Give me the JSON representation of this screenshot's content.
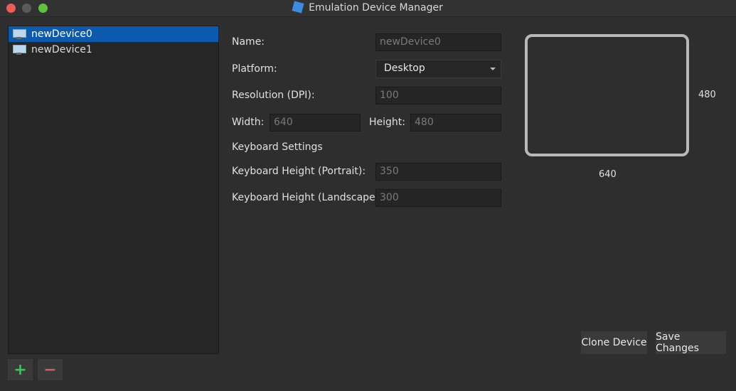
{
  "window": {
    "title": "Emulation Device Manager"
  },
  "devices": [
    {
      "label": "newDevice0",
      "selected": true
    },
    {
      "label": "newDevice1",
      "selected": false
    }
  ],
  "form": {
    "name_label": "Name:",
    "name_value": "newDevice0",
    "platform_label": "Platform:",
    "platform_value": "Desktop",
    "resolution_label": "Resolution (DPI):",
    "resolution_value": "100",
    "width_label": "Width:",
    "width_value": "640",
    "height_label": "Height:",
    "height_value": "480",
    "keyboard_section": "Keyboard Settings",
    "kb_portrait_label": "Keyboard Height (Portrait):",
    "kb_portrait_value": "350",
    "kb_landscape_label": "Keyboard Height (Landscape):",
    "kb_landscape_value": "300"
  },
  "preview": {
    "width": "640",
    "height": "480"
  },
  "buttons": {
    "clone": "Clone Device",
    "save": "Save Changes",
    "add": "+",
    "remove": "−"
  },
  "colors": {
    "accent": "#0c5aad",
    "add": "#2ecc55",
    "remove": "#d06060"
  }
}
